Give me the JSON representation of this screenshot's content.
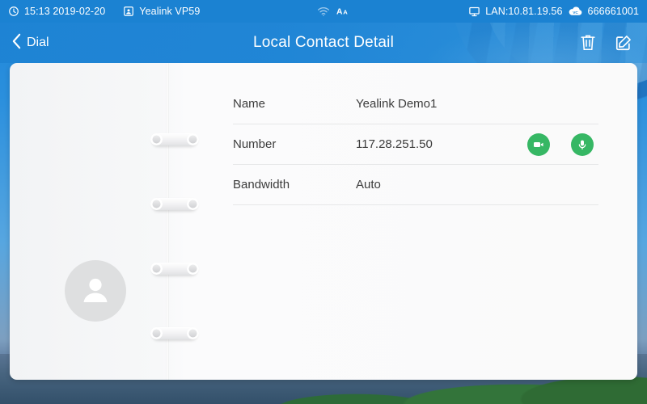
{
  "statusbar": {
    "clock_icon": "clock-icon",
    "datetime": "15:13 2019-02-20",
    "device_icon": "contact-card-icon",
    "device_name": "Yealink VP59",
    "wifi_icon": "wifi-icon",
    "font_size_icon": "font-size-icon",
    "lan_icon": "monitor-icon",
    "lan_text": "LAN:10.81.19.56",
    "cloud_icon": "vc-cloud-icon",
    "cloud_badge_text": "VC",
    "account_number": "666661001"
  },
  "titlebar": {
    "back_icon": "chevron-left-icon",
    "back_label": "Dial",
    "title": "Local Contact Detail",
    "delete_icon": "trash-icon",
    "edit_icon": "edit-pencil-icon"
  },
  "card": {
    "avatar_icon": "person-placeholder-icon",
    "binder_rings": 4
  },
  "details": {
    "rows": [
      {
        "label": "Name",
        "value": "Yealink Demo1",
        "actions": []
      },
      {
        "label": "Number",
        "value": "117.28.251.50",
        "actions": [
          "video-call-icon",
          "audio-call-icon"
        ]
      },
      {
        "label": "Bandwidth",
        "value": "Auto",
        "actions": []
      }
    ]
  },
  "colors": {
    "accent_blue": "#1b82d2",
    "call_green": "#36b764",
    "card_bg": "#fafafa",
    "text_primary": "#3c3c3c",
    "divider": "#e6e7e8"
  }
}
